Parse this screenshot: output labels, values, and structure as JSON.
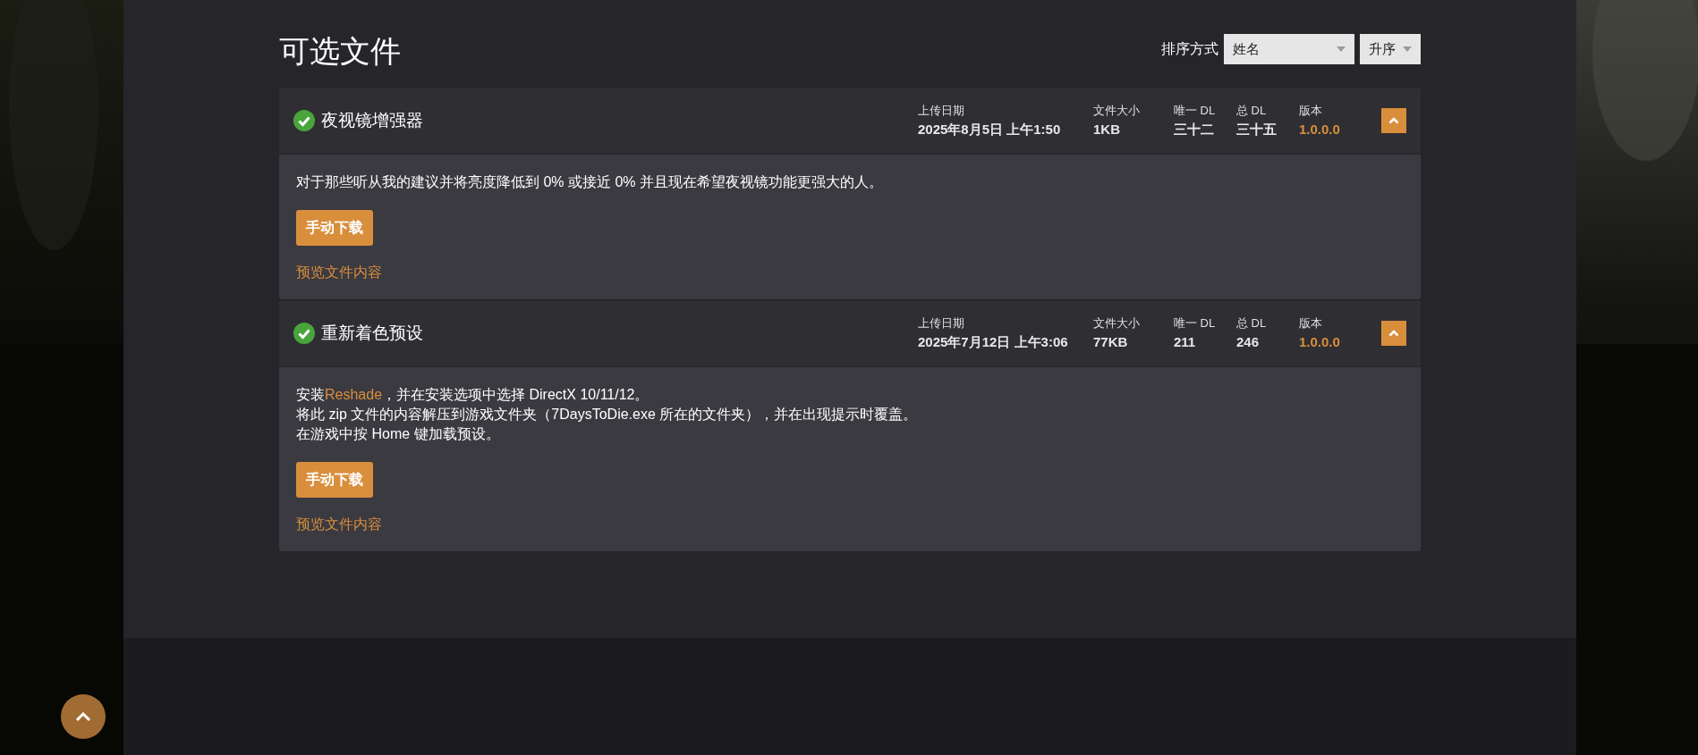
{
  "title": "可选文件",
  "sort": {
    "label": "排序方式",
    "field": "姓名",
    "order": "升序"
  },
  "files": [
    {
      "name": "夜视镜增强器",
      "verified": true,
      "expanded": true,
      "columns": [
        {
          "label": "上传日期",
          "value": "2025年8月5日 上午1:50",
          "kind": "text"
        },
        {
          "label": "文件大小",
          "value": "1KB",
          "kind": "text"
        },
        {
          "label": "唯一 DL",
          "value": "三十二",
          "kind": "text"
        },
        {
          "label": "总 DL",
          "value": "三十五",
          "kind": "text"
        },
        {
          "label": "版本",
          "value": "1.0.0.0",
          "kind": "version"
        }
      ],
      "description": [
        [
          {
            "kind": "text",
            "text": "对于那些听从我的建议并将亮度降低到 0% 或接近 0% 并且现在希望夜视镜功能更强大的人。"
          }
        ]
      ],
      "download": "手动下载",
      "preview": "预览文件内容"
    },
    {
      "name": "重新着色预设",
      "verified": true,
      "expanded": true,
      "columns": [
        {
          "label": "上传日期",
          "value": "2025年7月12日 上午3:06",
          "kind": "text"
        },
        {
          "label": "文件大小",
          "value": "77KB",
          "kind": "text"
        },
        {
          "label": "唯一 DL",
          "value": "211",
          "kind": "text"
        },
        {
          "label": "总 DL",
          "value": "246",
          "kind": "text"
        },
        {
          "label": "版本",
          "value": "1.0.0.0",
          "kind": "version"
        }
      ],
      "description": [
        [
          {
            "kind": "text",
            "text": "安装"
          },
          {
            "kind": "link",
            "text": "Reshade"
          },
          {
            "kind": "text",
            "text": "，并在安装选项中选择 DirectX 10/11/12。"
          }
        ],
        [
          {
            "kind": "text",
            "text": "将此 zip 文件的内容解压到游戏文件夹（7DaysToDie.exe 所在的文件夹），并在出现提示时覆盖。"
          }
        ],
        [
          {
            "kind": "text",
            "text": "在游戏中按 Home 键加载预设。"
          }
        ]
      ],
      "download": "手动下载",
      "preview": "预览文件内容"
    }
  ]
}
